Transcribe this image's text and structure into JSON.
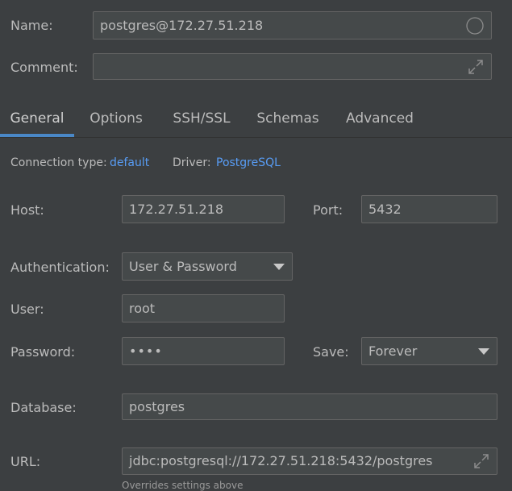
{
  "name": {
    "label": "Name:",
    "value": "postgres@172.27.51.218"
  },
  "comment": {
    "label": "Comment:",
    "value": ""
  },
  "tabs": [
    {
      "label": "General",
      "active": true
    },
    {
      "label": "Options",
      "active": false
    },
    {
      "label": "SSH/SSL",
      "active": false
    },
    {
      "label": "Schemas",
      "active": false
    },
    {
      "label": "Advanced",
      "active": false
    }
  ],
  "connection": {
    "type_label": "Connection type:",
    "type_value": "default",
    "driver_label": "Driver:",
    "driver_value": "PostgreSQL"
  },
  "host": {
    "label": "Host:",
    "value": "172.27.51.218"
  },
  "port": {
    "label": "Port:",
    "value": "5432"
  },
  "authentication": {
    "label": "Authentication:",
    "value": "User & Password"
  },
  "user": {
    "label": "User:",
    "value": "root"
  },
  "password": {
    "label": "Password:",
    "value": "••••"
  },
  "save": {
    "label": "Save:",
    "value": "Forever"
  },
  "database": {
    "label": "Database:",
    "value": "postgres"
  },
  "url": {
    "label": "URL:",
    "value": "jdbc:postgresql://172.27.51.218:5432/postgres",
    "note": "Overrides settings above"
  },
  "colors": {
    "background": "#3c3f41",
    "field": "#45494a",
    "accent": "#4a88c7",
    "link": "#589df6"
  },
  "icons": [
    "circle-icon",
    "expand-icon",
    "dropdown-arrow-icon"
  ]
}
